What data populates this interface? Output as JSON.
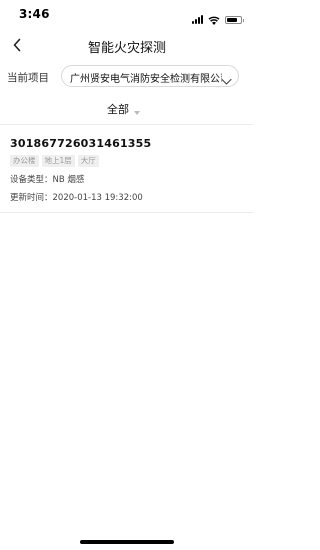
{
  "status_bar": {
    "time": "3:46",
    "battery_level": 0.8
  },
  "nav": {
    "title": "智能火灾探测",
    "back_icon": "chevron-left-icon"
  },
  "project": {
    "label": "当前项目",
    "value": "广州贤安电气消防安全检测有限公司",
    "dropdown_icon": "chevron-down-icon"
  },
  "filter": {
    "label": "全部",
    "dropdown_icon": "caret-down-icon"
  },
  "devices": [
    {
      "id": "301867726031461355",
      "tags": [
        "办公楼",
        "地上1层",
        "大厅"
      ],
      "type_line": "设备类型：NB 烟感",
      "time_line": "更新时间：2020-01-13 19:32:00"
    }
  ],
  "colors": {
    "text_primary": "#111111",
    "tag_bg": "#efefef",
    "tag_text": "#9a9a9a",
    "divider": "#eeeeee"
  }
}
